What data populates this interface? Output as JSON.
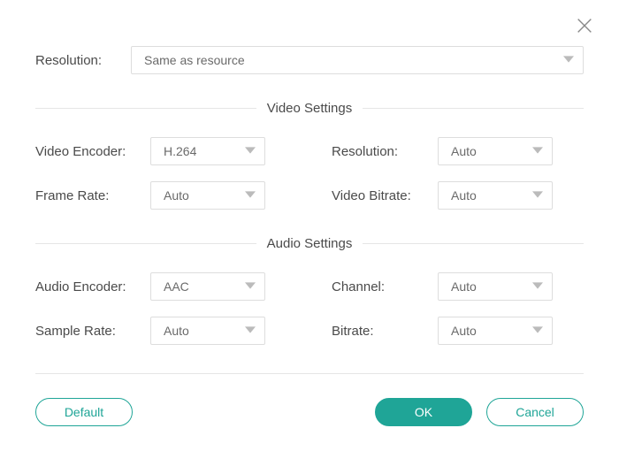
{
  "top": {
    "resolution_label": "Resolution:",
    "resolution_value": "Same as resource"
  },
  "video": {
    "section_title": "Video Settings",
    "encoder_label": "Video Encoder:",
    "encoder_value": "H.264",
    "resolution_label": "Resolution:",
    "resolution_value": "Auto",
    "frame_rate_label": "Frame Rate:",
    "frame_rate_value": "Auto",
    "bitrate_label": "Video Bitrate:",
    "bitrate_value": "Auto"
  },
  "audio": {
    "section_title": "Audio Settings",
    "encoder_label": "Audio Encoder:",
    "encoder_value": "AAC",
    "channel_label": "Channel:",
    "channel_value": "Auto",
    "sample_rate_label": "Sample Rate:",
    "sample_rate_value": "Auto",
    "bitrate_label": "Bitrate:",
    "bitrate_value": "Auto"
  },
  "buttons": {
    "default": "Default",
    "ok": "OK",
    "cancel": "Cancel"
  },
  "colors": {
    "accent": "#1fa597"
  }
}
